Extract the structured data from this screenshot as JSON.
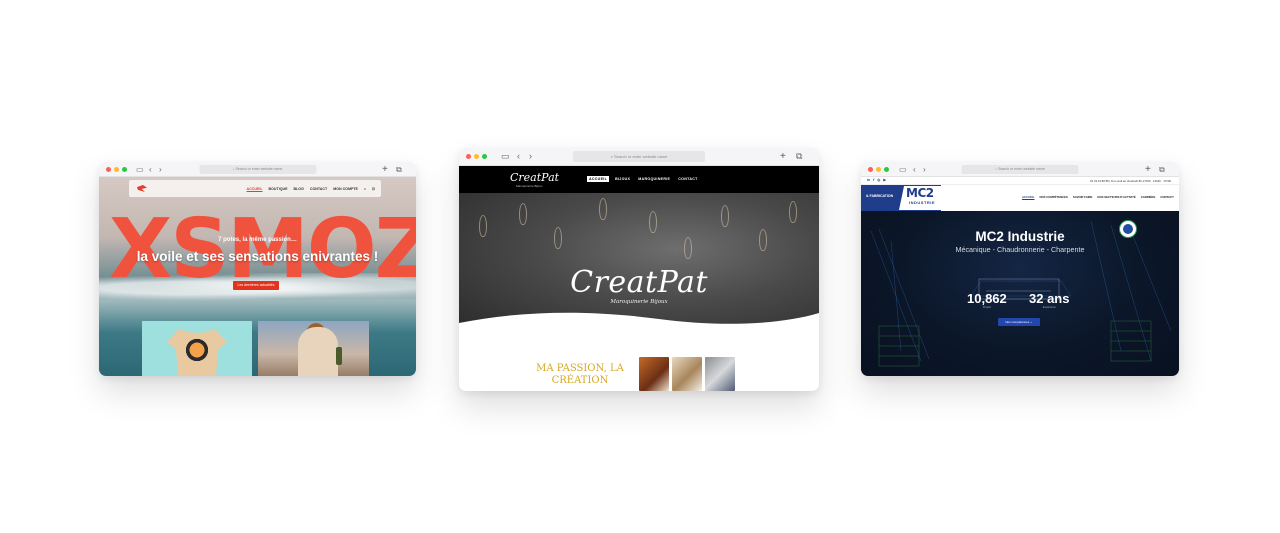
{
  "address_placeholder": "Search or enter website name",
  "xsmoz": {
    "menu": [
      "ACCUEIL",
      "BOUTIQUE",
      "BLOG",
      "CONTACT",
      "MON COMPTE"
    ],
    "brand": "XSMOZ",
    "tagline": "7 potes, la même passion…",
    "headline": "la voile et ses sensations enivrantes !",
    "cta": "Les dernières actualités"
  },
  "creatpat": {
    "logo": "CreatPat",
    "logo_sub": "Maroquinerie Bijoux",
    "menu": [
      "ACCUEIL",
      "BIJOUX",
      "MAROQUINERIE",
      "CONTACT"
    ],
    "title": "CreatPat",
    "subtitle": "Maroquinerie Bijoux",
    "passion": "MA PASSION, LA CRÉATION"
  },
  "mc2": {
    "social": [
      "in",
      "f",
      "◎",
      "▶"
    ],
    "contact": "02 33 43 88 88 | Du Lundi au Vendredi 8h-17h00 · 13h30 · 17h00",
    "band": "& FABRICATION",
    "logo": "MC2",
    "logo_sub": "INDUSTRIE",
    "menu": [
      "ACCUEIL",
      "NOS COMPÉTENCES",
      "SAVOIR FAIRE",
      "NOS SECTEURS D'ACTIVITÉ",
      "CARRIÈRE",
      "CONTACT"
    ],
    "title": "MC2 Industrie",
    "subtitle": "Mécanique - Chaudronnerie - Charpente",
    "stats": [
      {
        "value": "10,862",
        "label": "Projets"
      },
      {
        "value": "32 ans",
        "label": "Expérience"
      }
    ],
    "cta": "Nos compétences ⌄"
  },
  "colors": {
    "xsmoz_red": "#f0533d",
    "creatpat_gold": "#d6a826",
    "mc2_blue": "#1f3d8a"
  }
}
